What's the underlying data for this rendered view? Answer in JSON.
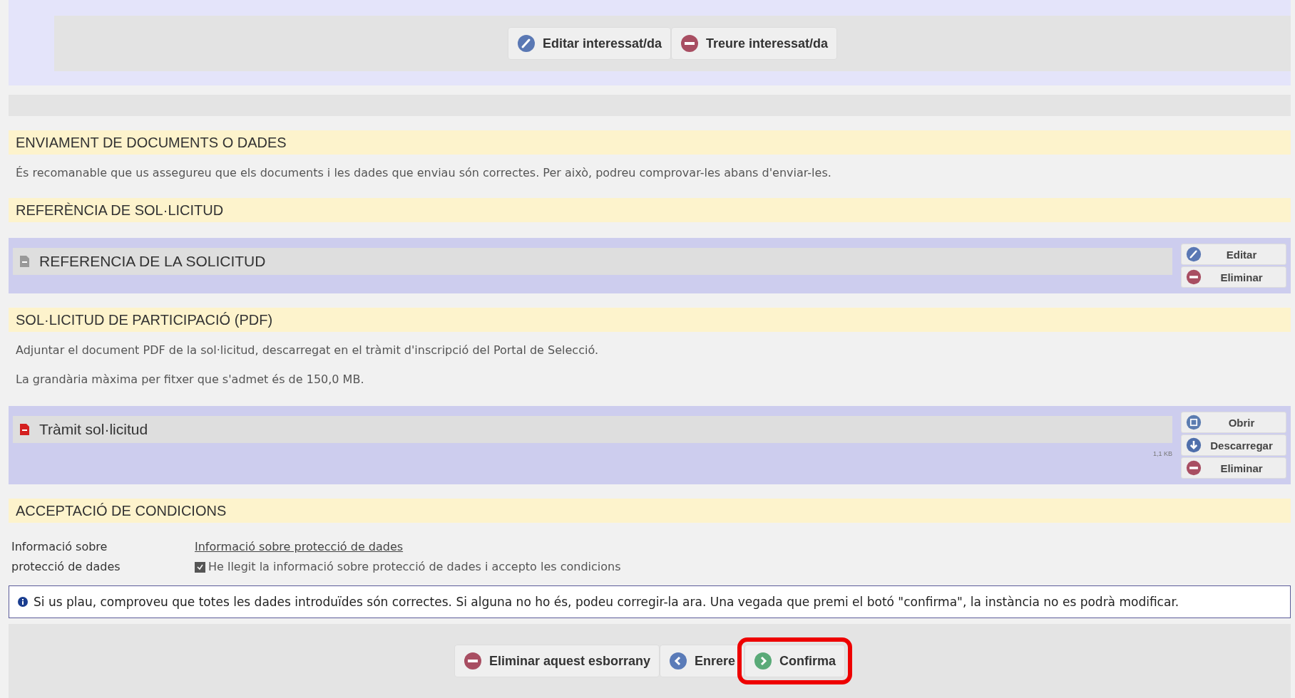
{
  "person_actions": [
    {
      "kind": "edit",
      "label": "Editar interessat/da"
    },
    {
      "kind": "remove",
      "label": "Treure interessat/da"
    }
  ],
  "sections": [
    {
      "title": "ENVIAMENT DE DOCUMENTS O DADES",
      "paragraphs": [
        "És recomanable que us assegureu que els documents i les dades que enviau són correctes. Per això, podreu comprovar-les abans d'enviar-les."
      ]
    },
    {
      "title": "REFERÈNCIA DE SOL·LICITUD",
      "documents": [
        {
          "name": "REFERENCIA DE LA SOLICITUD",
          "kind": "generic",
          "actions": [
            {
              "kind": "edit",
              "label": "Editar"
            },
            {
              "kind": "remove",
              "label": "Eliminar"
            }
          ]
        }
      ]
    },
    {
      "title": "SOL·LICITUD DE PARTICIPACIÓ (PDF)",
      "paragraphs": [
        "Adjuntar el document PDF de la sol·licitud, descarregat en el tràmit d'inscripció del Portal de Selecció.",
        "La grandària màxima per fitxer que s'admet és de 150,0 MB."
      ],
      "documents": [
        {
          "name": "Tràmit sol·licitud",
          "kind": "pdf",
          "size": "1,1 KB",
          "actions": [
            {
              "kind": "open",
              "label": "Obrir"
            },
            {
              "kind": "download",
              "label": "Descarregar"
            },
            {
              "kind": "remove",
              "label": "Eliminar"
            }
          ]
        }
      ]
    },
    {
      "title": "ACCEPTACIÓ DE CONDICIONS"
    }
  ],
  "conditions": {
    "label": "Informació sobre protecció de dades",
    "link": "Informació sobre protecció de dades",
    "checkbox": {
      "label": "He llegit la informació sobre protecció de dades i accepto les condicions",
      "checked": true
    }
  },
  "notice": "Si us plau, comproveu que totes les dades introduïdes són correctes. Si alguna no ho és, podeu corregir-la ara. Una vegada que premi el botó \"confirma\", la instància no es podrà modificar.",
  "footer_actions": [
    {
      "kind": "remove",
      "label": "Eliminar aquest esborrany",
      "highlighted": false
    },
    {
      "kind": "back",
      "label": "Enrere",
      "highlighted": false
    },
    {
      "kind": "confirm",
      "label": "Confirma",
      "highlighted": true
    }
  ]
}
